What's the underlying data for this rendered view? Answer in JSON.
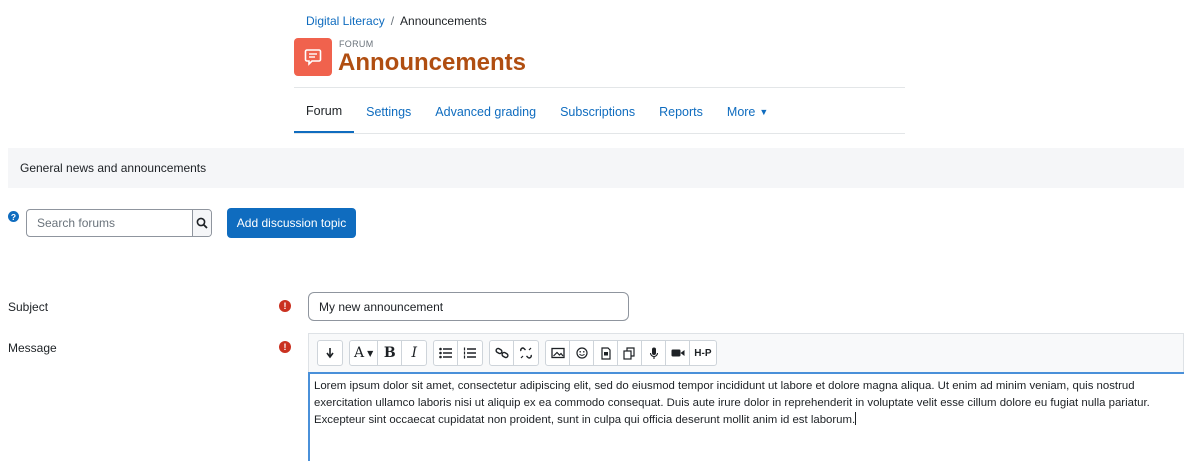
{
  "breadcrumb": {
    "course": "Digital Literacy",
    "separator": "/",
    "current": "Announcements"
  },
  "header": {
    "kind": "FORUM",
    "title": "Announcements",
    "icon": "forum-icon",
    "icon_color": "#f0624d",
    "title_color": "#b04e11"
  },
  "tabs": [
    {
      "label": "Forum",
      "active": true
    },
    {
      "label": "Settings"
    },
    {
      "label": "Advanced grading"
    },
    {
      "label": "Subscriptions"
    },
    {
      "label": "Reports"
    },
    {
      "label": "More"
    }
  ],
  "intro": "General news and announcements",
  "search": {
    "placeholder": "Search forums",
    "icon": "search-icon"
  },
  "add_button": "Add discussion topic",
  "form": {
    "subject_label": "Subject",
    "subject_value": "My new announcement",
    "message_label": "Message",
    "message_text": "Lorem ipsum dolor sit amet, consectetur adipiscing elit, sed do eiusmod tempor incididunt ut labore et dolore magna aliqua. Ut enim ad minim veniam, quis nostrud exercitation ullamco laboris nisi ut aliquip ex ea commodo consequat. Duis aute irure dolor in reprehenderit in voluptate velit esse cillum dolore eu fugiat nulla pariatur. Excepteur sint occaecat cupidatat non proident, sunt in culpa qui officia deserunt mollit anim id est laborum."
  },
  "toolbar": {
    "h5p_label": "H-P",
    "bold_label": "B",
    "italic_label": "I",
    "font_label": "A"
  },
  "colors": {
    "link": "#0f6cbf",
    "required": "#ca3120",
    "accent": "#0f6cbf"
  }
}
